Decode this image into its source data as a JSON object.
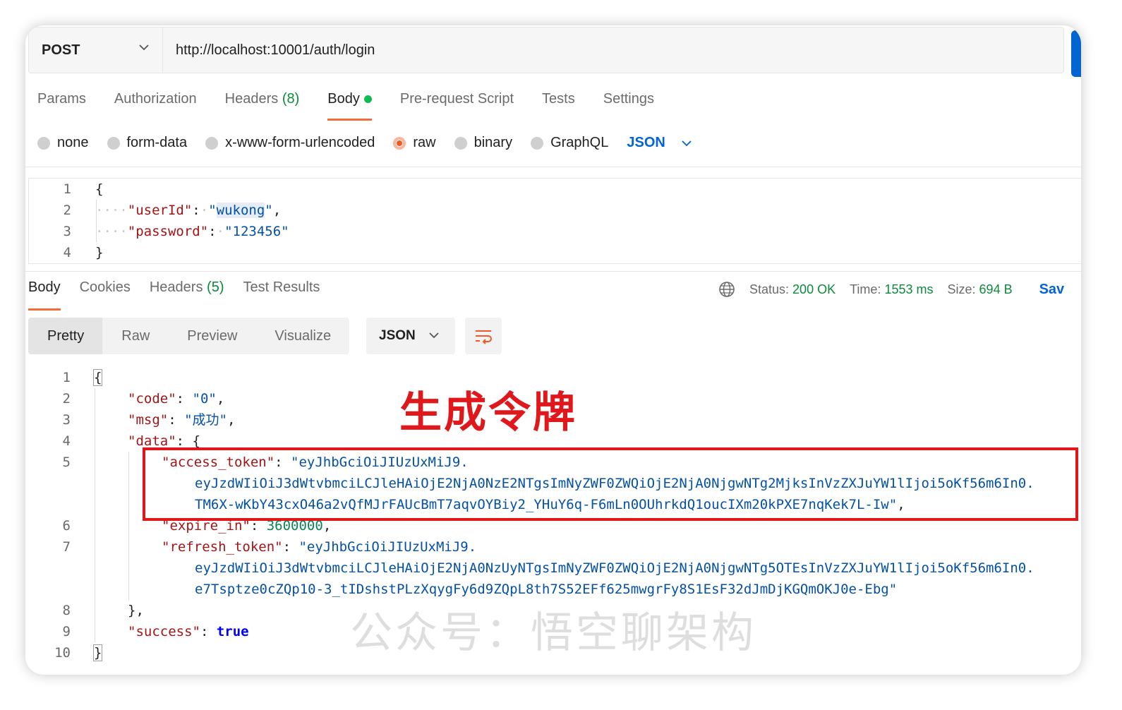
{
  "request": {
    "method": "POST",
    "url": "http://localhost:10001/auth/login"
  },
  "request_tabs": [
    {
      "label": "Params"
    },
    {
      "label": "Authorization"
    },
    {
      "label": "Headers",
      "count": "(8)"
    },
    {
      "label": "Body"
    },
    {
      "label": "Pre-request Script"
    },
    {
      "label": "Tests"
    },
    {
      "label": "Settings"
    }
  ],
  "body_types": [
    "none",
    "form-data",
    "x-www-form-urlencoded",
    "raw",
    "binary",
    "GraphQL"
  ],
  "body_format": "JSON",
  "request_body": {
    "line_numbers": [
      "1",
      "2",
      "3",
      "4"
    ],
    "open": "{",
    "userId_key": "\"userId\"",
    "userId_value_q1": "\"",
    "userId_value": "wukong",
    "userId_value_q2": "\"",
    "password_key": "\"password\"",
    "password_value": "\"123456\"",
    "close": "}"
  },
  "response_tabs": [
    {
      "label": "Body"
    },
    {
      "label": "Cookies"
    },
    {
      "label": "Headers",
      "count": "(5)"
    },
    {
      "label": "Test Results"
    }
  ],
  "response_status": {
    "status_label": "Status:",
    "status_value": "200 OK",
    "time_label": "Time:",
    "time_value": "1553 ms",
    "size_label": "Size:",
    "size_value": "694 B",
    "save_label": "Sav"
  },
  "view_modes": [
    "Pretty",
    "Raw",
    "Preview",
    "Visualize"
  ],
  "response_format": "JSON",
  "response_body": {
    "line_numbers": [
      "1",
      "2",
      "3",
      "4",
      "5",
      "",
      "",
      "6",
      "7",
      "",
      "",
      "8",
      "9",
      "10"
    ],
    "open": "{",
    "code_key": "\"code\"",
    "code_value": "\"0\"",
    "msg_key": "\"msg\"",
    "msg_value": "\"成功\"",
    "data_key": "\"data\"",
    "access_token_key": "\"access_token\"",
    "access_token_part1": "\"eyJhbGciOiJIUzUxMiJ9.",
    "access_token_part2": "eyJzdWIiOiJ3dWtvbmciLCJleHAiOjE2NjA0NzE2NTgsImNyZWF0ZWQiOjE2NjA0NjgwNTg2MjksInVzZXJuYW1lIjoi5oKf56m6In0.",
    "access_token_part3": "TM6X-wKbY43cxO46a2vQfMJrFAUcBmT7aqvOYBiy2_YHuY6q-F6mLn0OUhrkdQ1oucIXm20kPXE7nqKek7L-Iw\"",
    "expire_in_key": "\"expire_in\"",
    "expire_in_value": "3600000",
    "refresh_token_key": "\"refresh_token\"",
    "refresh_token_part1": "\"eyJhbGciOiJIUzUxMiJ9.",
    "refresh_token_part2": "eyJzdWIiOiJ3dWtvbmciLCJleHAiOjE2NjA0NzUyNTgsImNyZWF0ZWQiOjE2NjA0NjgwNTg5OTEsInVzZXJuYW1lIjoi5oKf56m6In0.",
    "refresh_token_part3": "e7Tsptze0cZQp10-3_tIDshstPLzXqygFy6d9ZQpL8th7S52EFf625mwgrFy8S1EsF32dJmDjKGQmOKJ0e-Ebg\"",
    "data_close": "}",
    "success_key": "\"success\"",
    "success_value": "true",
    "close": "}"
  },
  "annotation": "生成令牌",
  "watermark": "公众号：悟空聊架构",
  "colors": {
    "accent_orange": "#f26b3a",
    "brand_blue": "#0265d2",
    "status_green": "#0b8a3c",
    "annotation_red": "#e0181c"
  }
}
